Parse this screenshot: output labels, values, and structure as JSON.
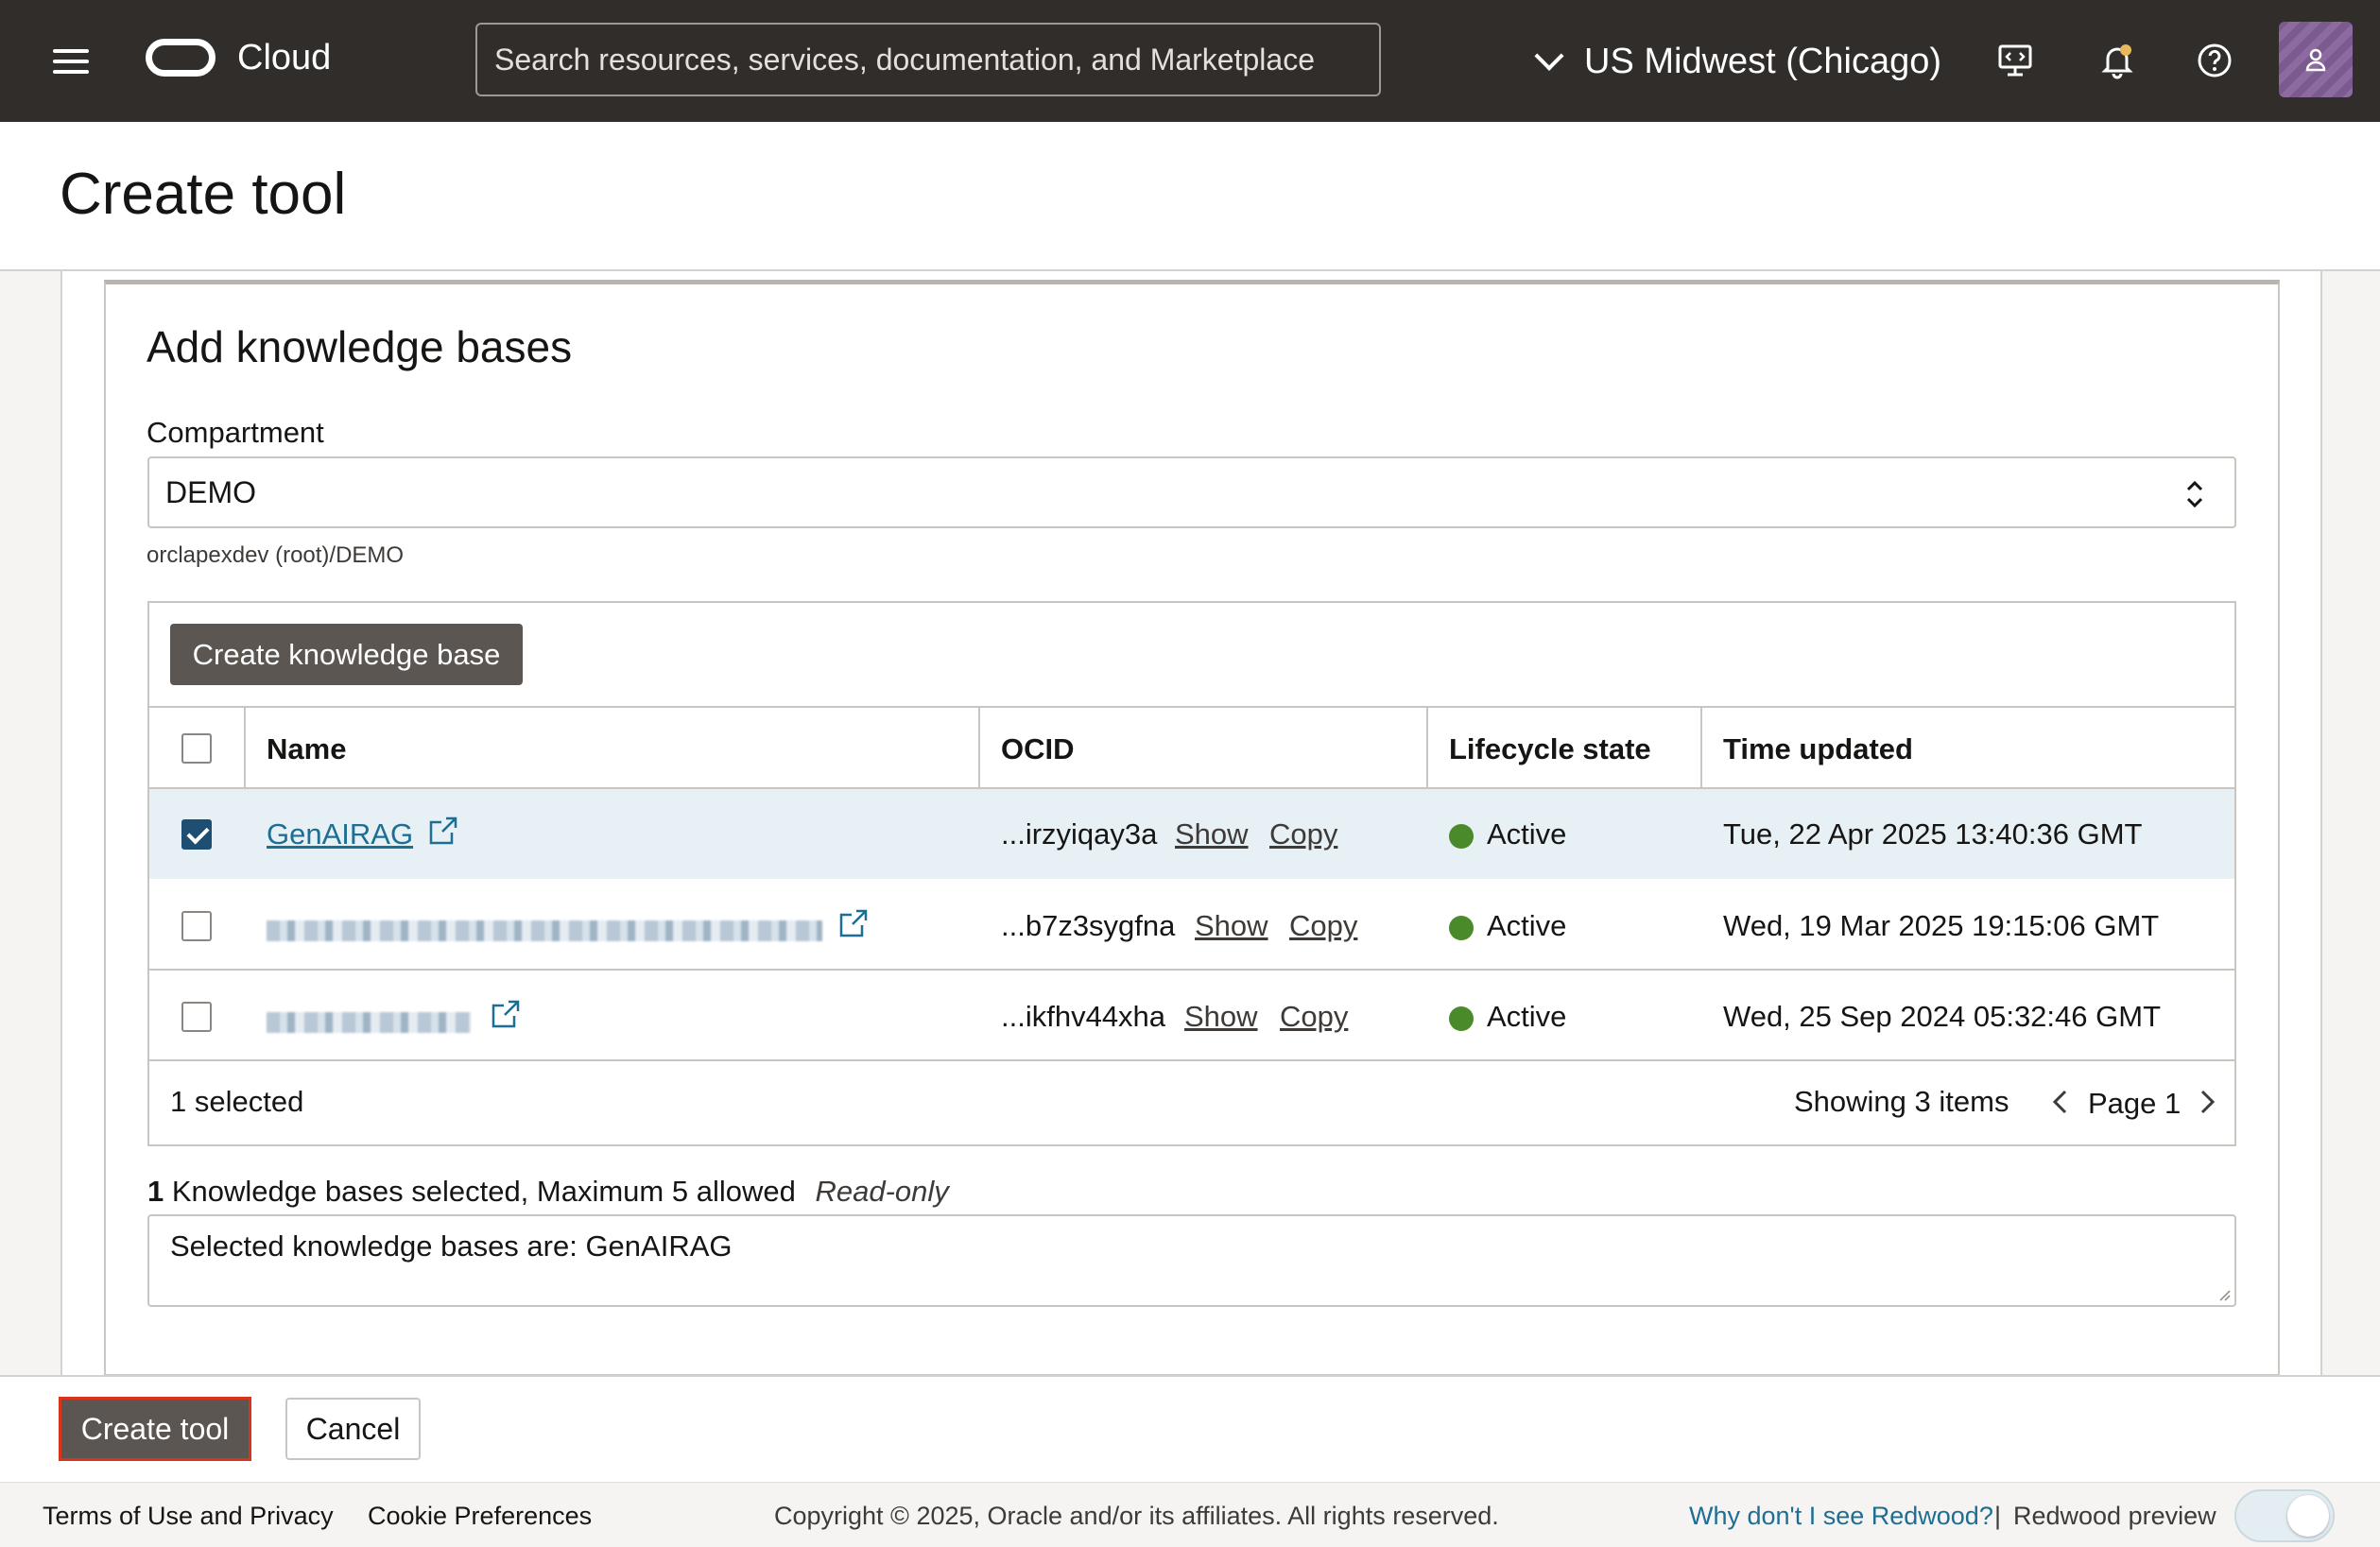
{
  "topbar": {
    "brand": "Cloud",
    "search_placeholder": "Search resources, services, documentation, and Marketplace",
    "region": "US Midwest (Chicago)"
  },
  "page": {
    "title": "Create tool"
  },
  "form": {
    "section_title": "Add knowledge bases",
    "compartment_label": "Compartment",
    "compartment_value": "DEMO",
    "compartment_path": "orclapexdev (root)/DEMO",
    "create_kb_label": "Create knowledge base",
    "columns": [
      "Name",
      "OCID",
      "Lifecycle state",
      "Time updated"
    ],
    "rows": [
      {
        "name": "GenAIRAG",
        "ocid": "...irzyiqay3a",
        "show": "Show",
        "copy": "Copy",
        "state": "Active",
        "updated": "Tue, 22 Apr 2025 13:40:36 GMT",
        "checked": true
      },
      {
        "name": "",
        "ocid": "...b7z3sygfna",
        "show": "Show",
        "copy": "Copy",
        "state": "Active",
        "updated": "Wed, 19 Mar 2025 19:15:06 GMT",
        "checked": false
      },
      {
        "name": "",
        "ocid": "...ikfhv44xha",
        "show": "Show",
        "copy": "Copy",
        "state": "Active",
        "updated": "Wed, 25 Sep 2024 05:32:46 GMT",
        "checked": false
      }
    ],
    "selected_count": "1 selected",
    "showing": "Showing 3 items",
    "page": "Page 1",
    "kb_count_num": "1",
    "kb_count_text": "Knowledge bases selected, Maximum 5 allowed",
    "read_only": "Read-only",
    "selected_text": "Selected knowledge bases are: GenAIRAG"
  },
  "actions": {
    "create": "Create tool",
    "cancel": "Cancel"
  },
  "footer": {
    "terms": "Terms of Use and Privacy",
    "cookies": "Cookie Preferences",
    "copyright": "Copyright © 2025, Oracle and/or its affiliates. All rights reserved.",
    "why": "Why don't I see Redwood?",
    "sep": "|",
    "preview": "Redwood preview"
  },
  "colors": {
    "topbar": "#312d2a",
    "primary_button": "#5c5652",
    "link": "#1e6e93",
    "active_dot": "#4a8a2a",
    "focus_border": "#d9341c"
  }
}
